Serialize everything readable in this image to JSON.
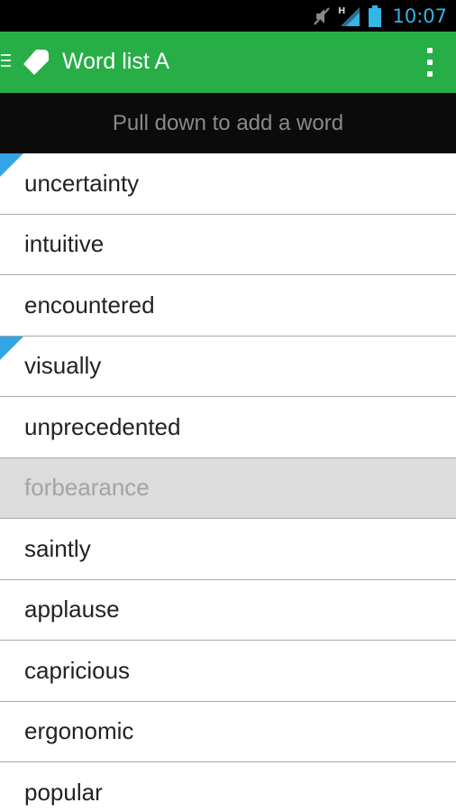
{
  "status_bar": {
    "time": "10:07",
    "network_label": "H",
    "icons": [
      "mute-icon",
      "signal-icon",
      "battery-icon"
    ],
    "accent_color": "#33b5e5"
  },
  "action_bar": {
    "title": "Word list A",
    "background_color": "#27ae47",
    "icons": [
      "drawer-indicator-icon",
      "app-logo-icon",
      "overflow-menu-icon"
    ]
  },
  "pull_hint": {
    "text": "Pull down to add a word"
  },
  "words": [
    {
      "label": "uncertainty",
      "marked": true,
      "dimmed": false
    },
    {
      "label": "intuitive",
      "marked": false,
      "dimmed": false
    },
    {
      "label": "encountered",
      "marked": false,
      "dimmed": false
    },
    {
      "label": "visually",
      "marked": true,
      "dimmed": false
    },
    {
      "label": "unprecedented",
      "marked": false,
      "dimmed": false
    },
    {
      "label": "forbearance",
      "marked": false,
      "dimmed": true
    },
    {
      "label": "saintly",
      "marked": false,
      "dimmed": false
    },
    {
      "label": "applause",
      "marked": false,
      "dimmed": false
    },
    {
      "label": "capricious",
      "marked": false,
      "dimmed": false
    },
    {
      "label": "ergonomic",
      "marked": false,
      "dimmed": false
    },
    {
      "label": "popular",
      "marked": false,
      "dimmed": false
    }
  ],
  "colors": {
    "marker": "#33a5e6",
    "dimmed_row": "#dcdcdc"
  }
}
